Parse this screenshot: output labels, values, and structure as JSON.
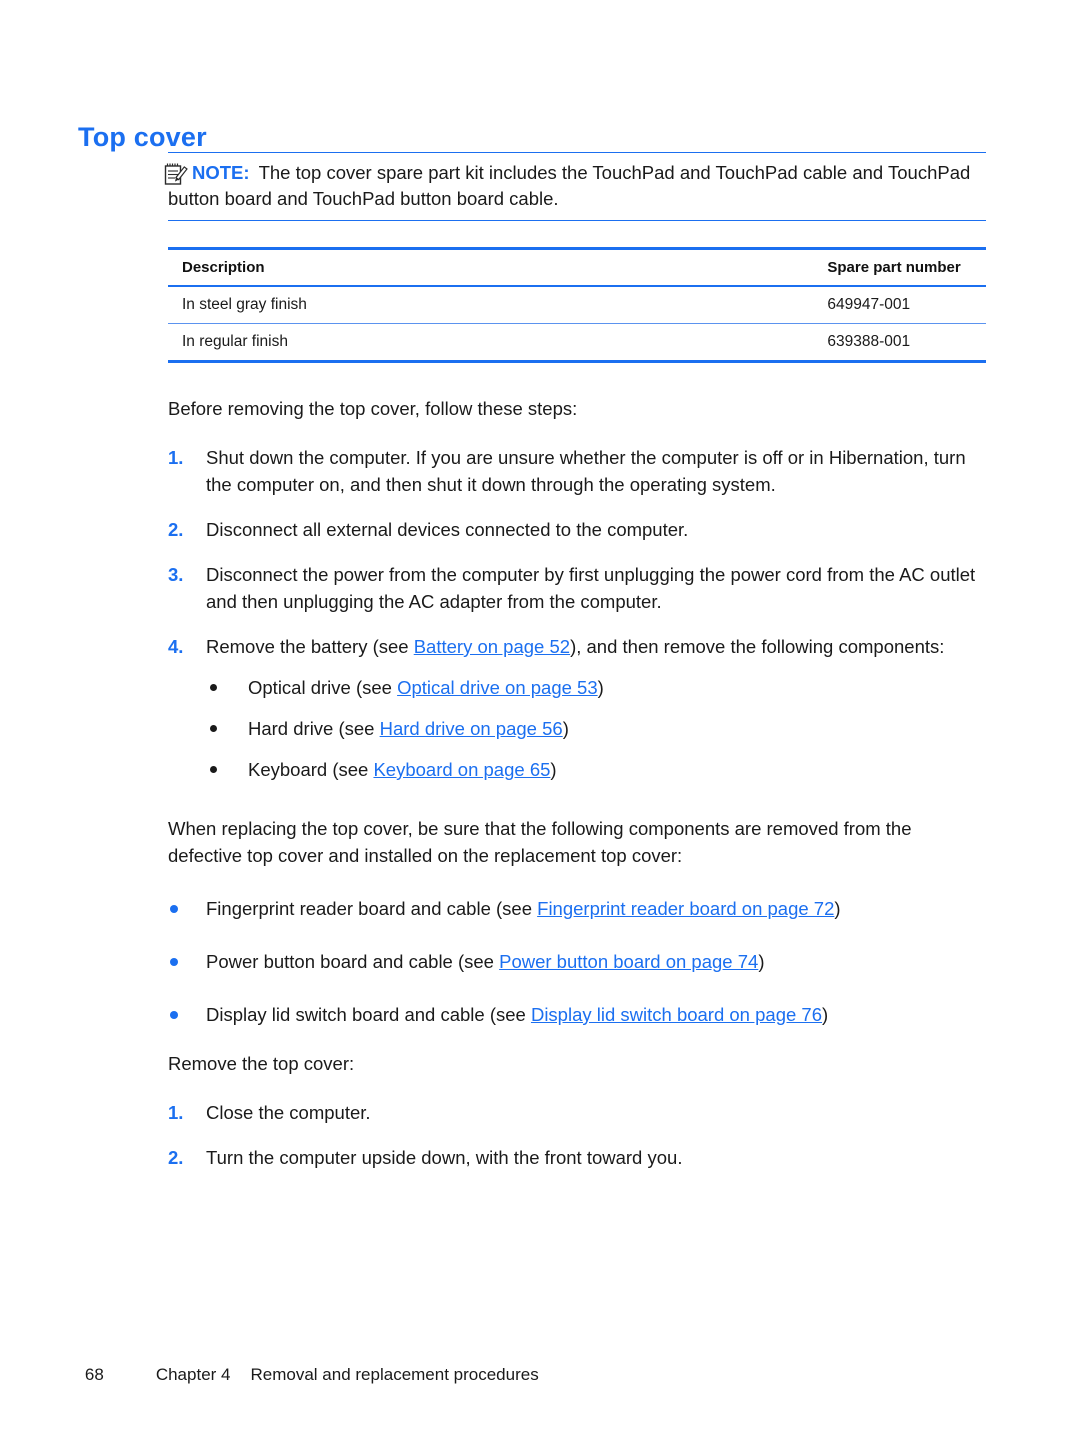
{
  "heading": "Top cover",
  "note": {
    "icon": "note-pad-pencil-icon",
    "label": "NOTE:",
    "text": "The top cover spare part kit includes the TouchPad and TouchPad cable and TouchPad button board and TouchPad button board cable."
  },
  "table": {
    "headers": [
      "Description",
      "Spare part number"
    ],
    "rows": [
      [
        "In steel gray finish",
        "649947-001"
      ],
      [
        "In regular finish",
        "639388-001"
      ]
    ]
  },
  "intro_before": "Before removing the top cover, follow these steps:",
  "steps_before": [
    {
      "num": "1.",
      "text": "Shut down the computer. If you are unsure whether the computer is off or in Hibernation, turn the computer on, and then shut it down through the operating system."
    },
    {
      "num": "2.",
      "text": "Disconnect all external devices connected to the computer."
    },
    {
      "num": "3.",
      "text": "Disconnect the power from the computer by first unplugging the power cord from the AC outlet and then unplugging the AC adapter from the computer."
    },
    {
      "num": "4.",
      "pre": "Remove the battery (see ",
      "link": "Battery on page 52",
      "post": "), and then remove the following components:"
    }
  ],
  "components": [
    {
      "pre": "Optical drive (see ",
      "link": "Optical drive on page 53",
      "post": ")"
    },
    {
      "pre": "Hard drive (see ",
      "link": "Hard drive on page 56",
      "post": ")"
    },
    {
      "pre": "Keyboard (see ",
      "link": "Keyboard on page 65",
      "post": ")"
    }
  ],
  "replace_para": "When replacing the top cover, be sure that the following components are removed from the defective top cover and installed on the replacement top cover:",
  "replace_items": [
    {
      "pre": "Fingerprint reader board and cable (see ",
      "link": "Fingerprint reader board on page 72",
      "post": ")"
    },
    {
      "pre": "Power button board and cable (see ",
      "link": "Power button board on page 74",
      "post": ")"
    },
    {
      "pre": "Display lid switch board and cable (see ",
      "link": "Display lid switch board on page 76",
      "post": ")"
    }
  ],
  "remove_intro": "Remove the top cover:",
  "steps_remove": [
    {
      "num": "1.",
      "text": "Close the computer."
    },
    {
      "num": "2.",
      "text": "Turn the computer upside down, with the front toward you."
    }
  ],
  "footer": {
    "page_number": "68",
    "chapter": "Chapter 4",
    "chapter_title": "Removal and replacement procedures"
  },
  "colors": {
    "accent_blue": "#1b6ff0",
    "text": "#1a1a1a",
    "background": "#ffffff"
  }
}
